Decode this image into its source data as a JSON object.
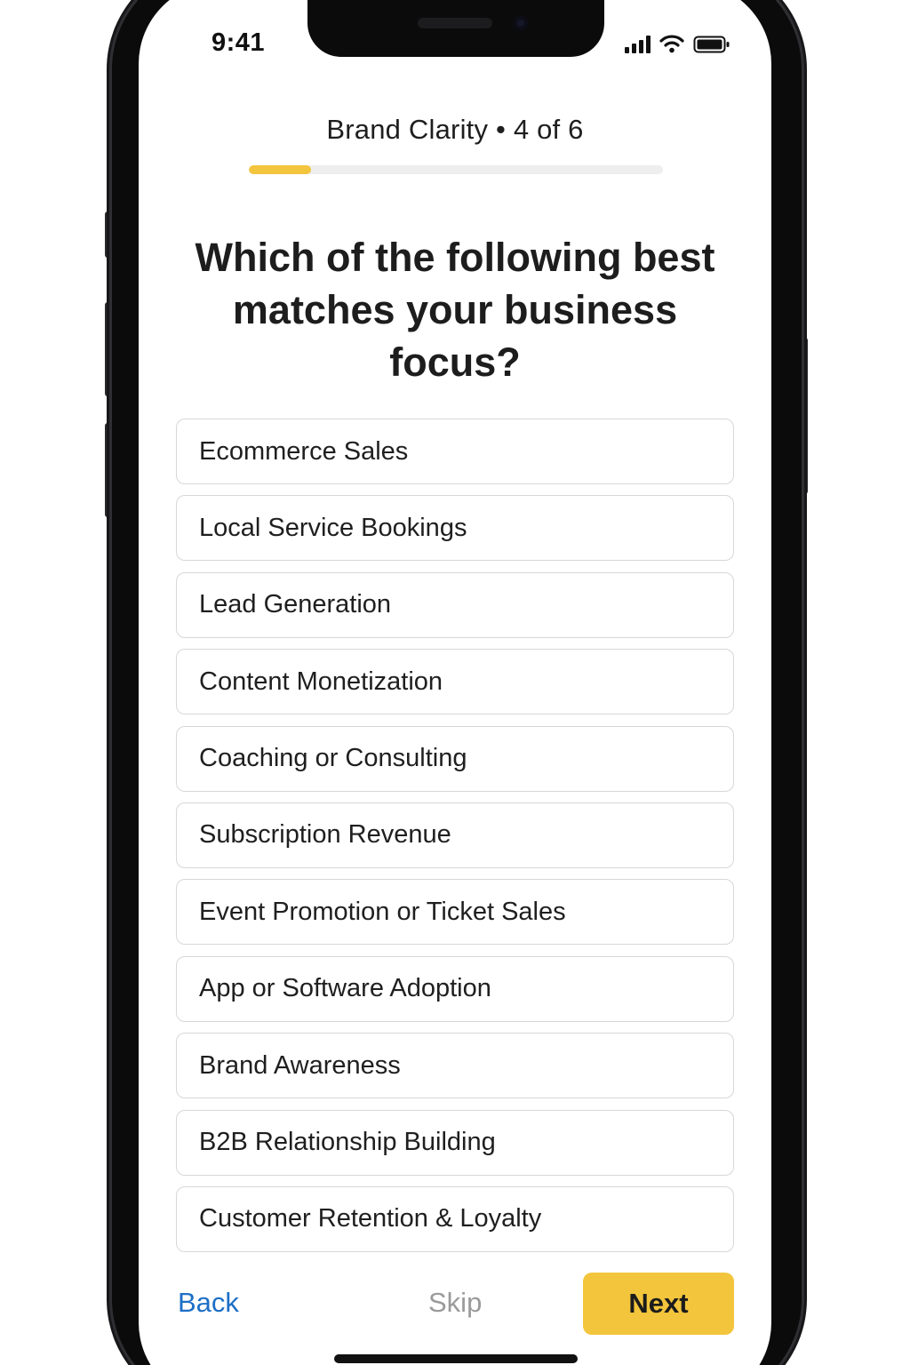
{
  "status_bar": {
    "time": "9:41",
    "icons": [
      "cellular-signal-icon",
      "wifi-icon",
      "battery-icon"
    ]
  },
  "header": {
    "title": "Brand Clarity • 4 of 6",
    "progress_fraction": 0.15,
    "progress_color": "#f3c53c"
  },
  "question": "Which of the following best matches your business focus?",
  "options": [
    "Ecommerce Sales",
    "Local Service Bookings",
    "Lead Generation",
    "Content Monetization",
    "Coaching or Consulting",
    "Subscription Revenue",
    "Event Promotion or Ticket Sales",
    "App or Software Adoption",
    "Brand Awareness",
    "B2B Relationship Building",
    "Customer Retention & Loyalty"
  ],
  "footer": {
    "back_label": "Back",
    "skip_label": "Skip",
    "next_label": "Next"
  },
  "colors": {
    "accent": "#f3c53c",
    "link": "#1e6fc6",
    "muted": "#9a9a9a"
  }
}
